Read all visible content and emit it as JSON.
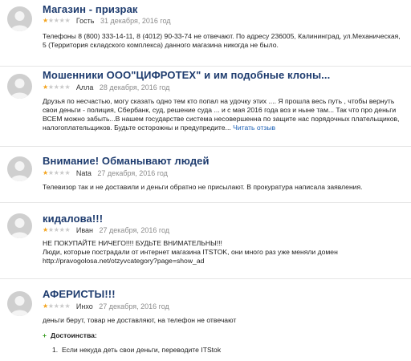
{
  "reviews": [
    {
      "title": "Магазин - призрак",
      "rating": 1,
      "author": "Гость",
      "date": "31 декабря, 2016 год",
      "body": "Телефоны 8 (800) 333-14-11, 8 (4012) 90-33-74 не отвечают. По адресу 236005, Калининград, ул.Механическая, 5 (Территория складского комплекса) данного магазина никогда не было."
    },
    {
      "title": "Мошенники ООО\"ЦИФРОТЕХ\" и им подобные клоны...",
      "rating": 1,
      "author": "Алла",
      "date": "28 декабря, 2016 год",
      "body": "Друзья по несчастью, могу сказать одно тем кто попал на удочку этих .... Я прошла весь путь , чтобы вернуть свои деньги - полиция, Сбербанк, суд, решение суда ... и с мая 2016 года воз и ныне там... Так что про деньги ВСЕМ можно забыть...В нашем государстве система несовершенна по защите нас порядочных плательщиков, налогоплательщиков. Будьте осторожны и предупредите...",
      "more": "Читать отзыв"
    },
    {
      "title": "Внимание! Обманывают людей",
      "rating": 1,
      "author": "Nata",
      "date": "27 декабря, 2016 год",
      "body": "Телевизор так и не доставили и деньги обратно не присылают. В прокуратура написала заявления."
    },
    {
      "title": "кидалова!!!",
      "rating": 1,
      "author": "Иван",
      "date": "27 декабря, 2016 год",
      "body_lines": [
        "НЕ ПОКУПАЙТЕ НИЧЕГО!!!! БУДЬТЕ ВНИМАТЕЛЬНЫ!!!",
        "Люди, которые пострадали от интернет магазина ITSTOK, они много раз уже меняли домен",
        "http://pravogolosa.net/otzyvcategory?page=show_ad"
      ]
    },
    {
      "title": "АФЕРИСТЫ!!!",
      "rating": 1,
      "author": "Инхо",
      "date": "27 декабря, 2016 год",
      "body": "деньги берут, товар не доставляют, на телефон не отвечают",
      "plus_title": "Достоинства:",
      "plus_items": [
        "Если некуда деть свои деньги, переводите ITStok"
      ]
    }
  ],
  "star_max": 5,
  "colors": {
    "title": "#1d3b6e",
    "star_on": "#f3a31b",
    "star_off": "#c9c9c9",
    "date": "#8b8b8b",
    "link": "#1a5fb4",
    "plus": "#3a9d23"
  }
}
